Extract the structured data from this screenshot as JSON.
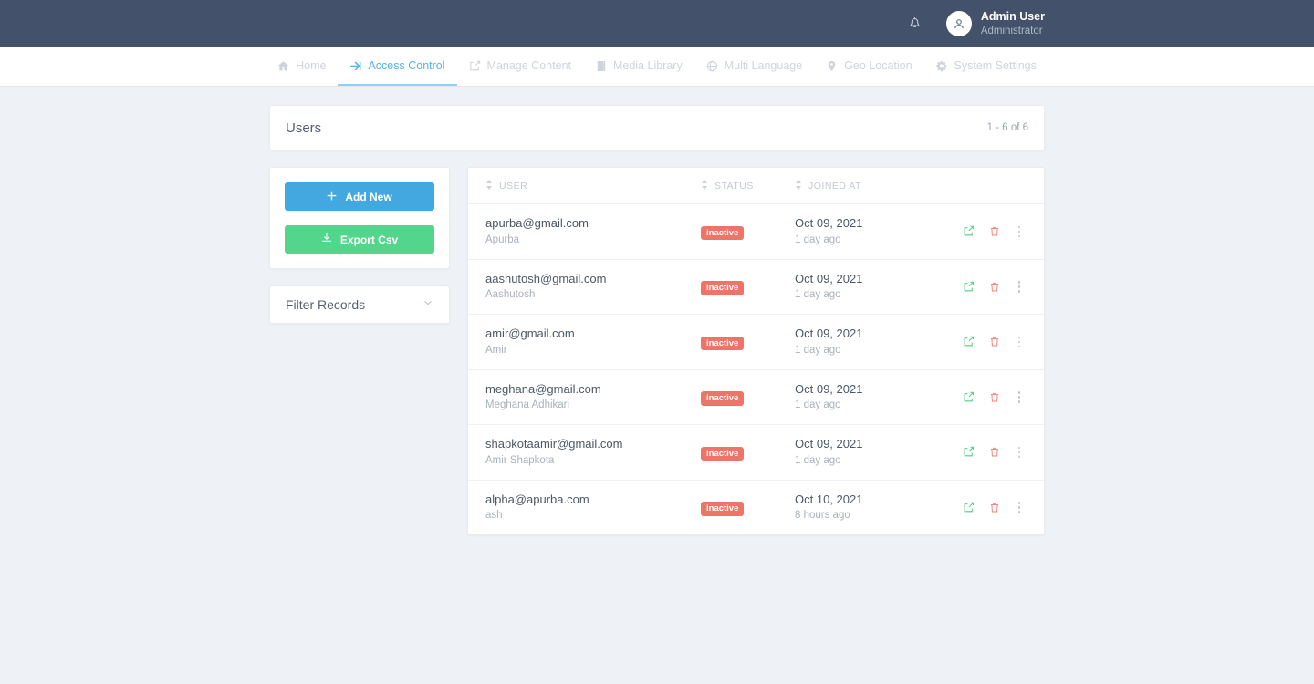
{
  "topbar": {
    "notifications_icon": "bell-icon",
    "avatar_icon": "user-avatar-icon",
    "user_name": "Admin User",
    "user_role": "Administrator",
    "background_color": "#43526a"
  },
  "nav": {
    "active_color": "#58b2e6",
    "items": [
      {
        "label": "Home",
        "icon": "home-icon",
        "active": false
      },
      {
        "label": "Access Control",
        "icon": "sign-in-icon",
        "active": true
      },
      {
        "label": "Manage Content",
        "icon": "edit-square-icon",
        "active": false
      },
      {
        "label": "Media Library",
        "icon": "book-icon",
        "active": false
      },
      {
        "label": "Multi Language",
        "icon": "globe-icon",
        "active": false
      },
      {
        "label": "Geo Location",
        "icon": "map-pin-icon",
        "active": false
      },
      {
        "label": "System Settings",
        "icon": "gear-icon",
        "active": false
      }
    ]
  },
  "header": {
    "title": "Users",
    "count": "1 - 6 of 6"
  },
  "actions": {
    "add_new": {
      "label": "Add New",
      "icon": "plus-icon",
      "color": "#44a8e0"
    },
    "export_csv": {
      "label": "Export Csv",
      "icon": "download-icon",
      "color": "#53d68c"
    }
  },
  "filter": {
    "label": "Filter Records",
    "chevron_icon": "chevron-down-icon"
  },
  "table": {
    "columns": [
      {
        "label": "User",
        "sort_icon": "sort-icon"
      },
      {
        "label": "Status",
        "sort_icon": "sort-icon"
      },
      {
        "label": "Joined At",
        "sort_icon": "sort-icon"
      }
    ],
    "row_actions": {
      "edit_icon": "edit-icon",
      "delete_icon": "trash-icon",
      "more_icon": "more-vertical-icon"
    },
    "badge_color": "#ed7469",
    "rows": [
      {
        "email": "apurba@gmail.com",
        "name": "Apurba",
        "status": "inactive",
        "joined": "Oct 09, 2021",
        "ago": "1 day ago"
      },
      {
        "email": "aashutosh@gmail.com",
        "name": "Aashutosh",
        "status": "inactive",
        "joined": "Oct 09, 2021",
        "ago": "1 day ago"
      },
      {
        "email": "amir@gmail.com",
        "name": "Amir",
        "status": "inactive",
        "joined": "Oct 09, 2021",
        "ago": "1 day ago"
      },
      {
        "email": "meghana@gmail.com",
        "name": "Meghana Adhikari",
        "status": "inactive",
        "joined": "Oct 09, 2021",
        "ago": "1 day ago"
      },
      {
        "email": "shapkotaamir@gmail.com",
        "name": "Amir Shapkota",
        "status": "inactive",
        "joined": "Oct 09, 2021",
        "ago": "1 day ago"
      },
      {
        "email": "alpha@apurba.com",
        "name": "ash",
        "status": "inactive",
        "joined": "Oct 10, 2021",
        "ago": "8 hours ago"
      }
    ]
  }
}
